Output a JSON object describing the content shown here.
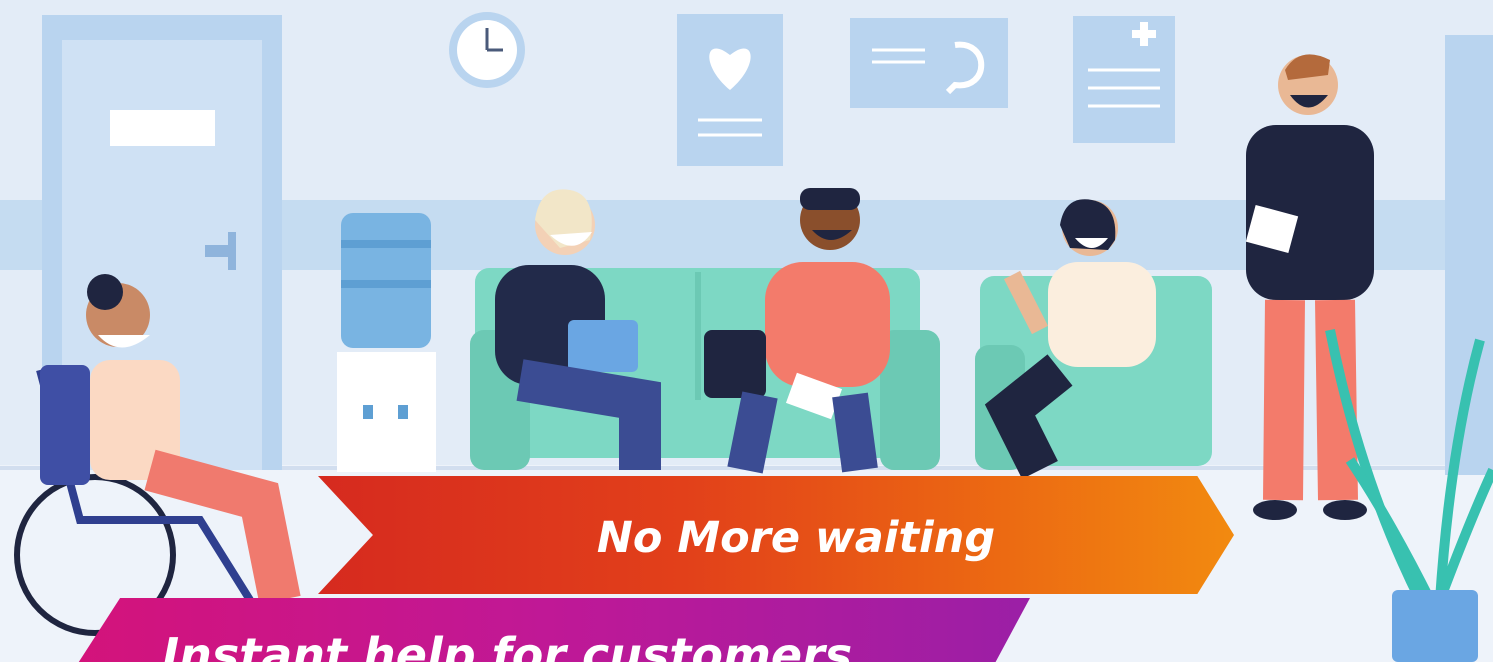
{
  "banners": {
    "primary": "No More waiting",
    "secondary": "Instant help for customers"
  },
  "palette": {
    "wall": "#e3ecf7",
    "sofa": "#7dd8c4",
    "primary_banner_start": "#d62a1f",
    "primary_banner_end": "#f28a10",
    "secondary_banner_start": "#d4137a",
    "secondary_banner_end": "#9b1fa6"
  }
}
